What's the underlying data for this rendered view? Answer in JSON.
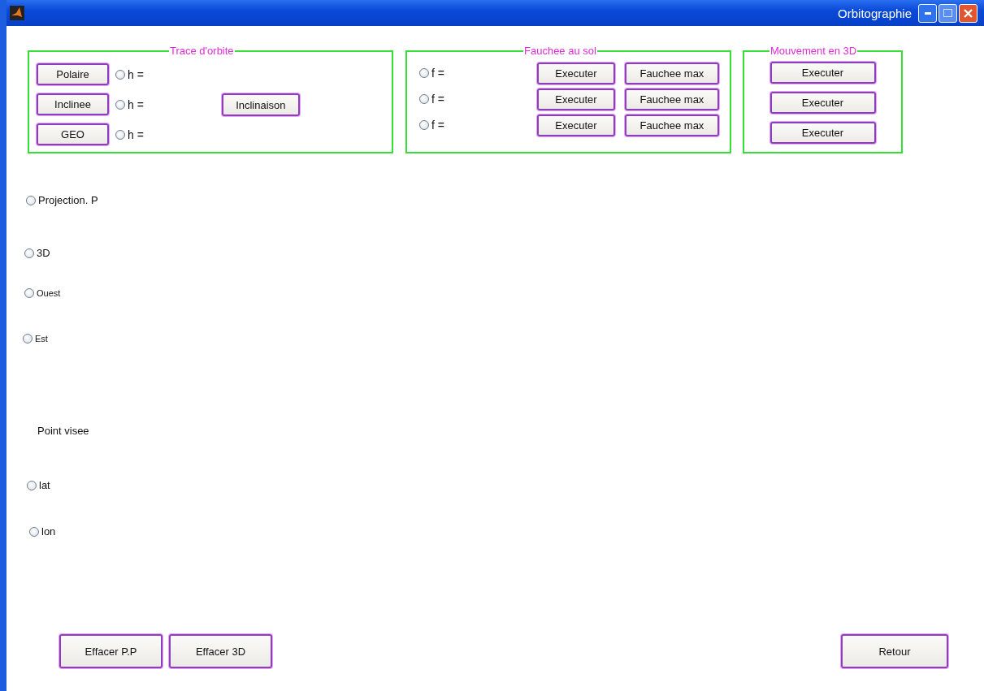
{
  "window": {
    "title": "Orbitographie"
  },
  "trace_orbite": {
    "title": "Trace d'orbite",
    "rows": [
      {
        "button": "Polaire",
        "radio": {
          "label": "h =",
          "checked": false
        }
      },
      {
        "button": "Inclinee",
        "radio": {
          "label": "h =",
          "checked": false
        }
      },
      {
        "button": "GEO",
        "radio": {
          "label": "h =",
          "checked": false
        }
      }
    ],
    "side_button": "Inclinaison"
  },
  "fauchee_au_sol": {
    "title": "Fauchee au sol",
    "rows": [
      {
        "radio": {
          "label": "f =",
          "checked": false
        },
        "execute": "Executer",
        "max": "Fauchee max"
      },
      {
        "radio": {
          "label": "f =",
          "checked": false
        },
        "execute": "Executer",
        "max": "Fauchee max"
      },
      {
        "radio": {
          "label": "f =",
          "checked": false
        },
        "execute": "Executer",
        "max": "Fauchee max"
      }
    ]
  },
  "mouvement_3d": {
    "title": "Mouvement en 3D",
    "buttons": [
      "Executer",
      "Executer",
      "Executer"
    ]
  },
  "left_items": [
    {
      "kind": "radio",
      "label": "Projection. P",
      "checked": false
    },
    {
      "kind": "radio",
      "label": "3D",
      "checked": false
    },
    {
      "kind": "radio",
      "label": "Ouest",
      "checked": false
    },
    {
      "kind": "radio",
      "label": "Est",
      "checked": false
    },
    {
      "kind": "text",
      "label": "Point visee"
    },
    {
      "kind": "radio",
      "label": "lat",
      "checked": false
    },
    {
      "kind": "radio",
      "label": "lon",
      "checked": false
    }
  ],
  "bottom_left_buttons": [
    "Effacer P.P",
    "Effacer 3D"
  ],
  "bottom_right_button": "Retour"
}
